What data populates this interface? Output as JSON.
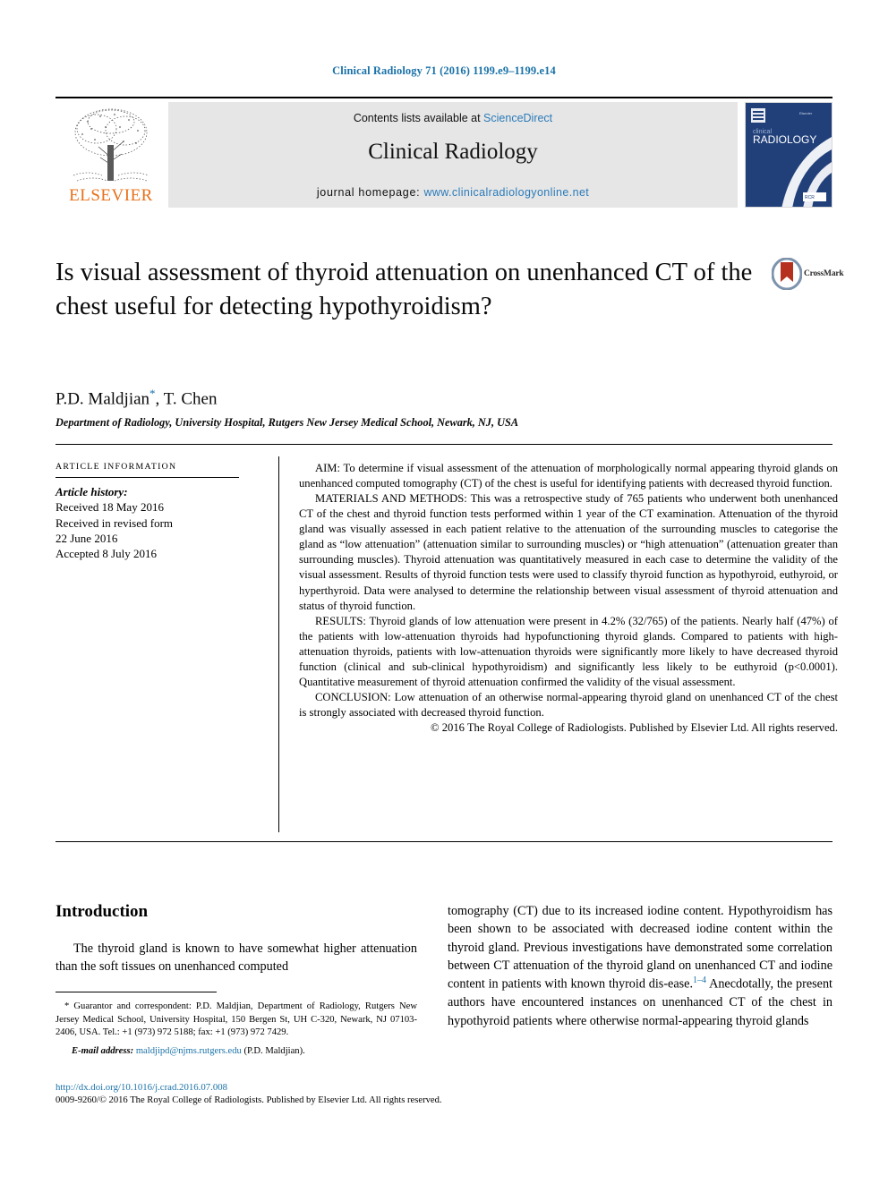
{
  "running_head": "Clinical Radiology 71 (2016) 1199.e9–1199.e14",
  "masthead": {
    "publisher_name": "ELSEVIER",
    "publisher_logo_icon": "elsevier-tree-icon",
    "contents_prefix": "Contents lists available at ",
    "contents_link": "ScienceDirect",
    "journal_name": "Clinical Radiology",
    "homepage_prefix": "journal homepage: ",
    "homepage_url": "www.clinicalradiologyonline.net",
    "cover_icon": "journal-cover-thumbnail",
    "cover_title_line1": "clinical",
    "cover_title_line2": "RADIOLOGY"
  },
  "crossmark": {
    "label": "CrossMark",
    "icon": "crossmark-icon"
  },
  "article": {
    "title": "Is visual assessment of thyroid attenuation on unenhanced CT of the chest useful for detecting hypothyroidism?",
    "authors": "P.D. Maldjian",
    "authors_marker": "*",
    "authors_rest": ", T. Chen",
    "affiliation": "Department of Radiology, University Hospital, Rutgers New Jersey Medical School, Newark, NJ, USA"
  },
  "article_information": {
    "heading": "ARTICLE INFORMATION",
    "history_label": "Article history:",
    "history": [
      "Received 18 May 2016",
      "Received in revised form",
      "22 June 2016",
      "Accepted 8 July 2016"
    ]
  },
  "abstract": {
    "aim": "AIM: To determine if visual assessment of the attenuation of morphologically normal appearing thyroid glands on unenhanced computed tomography (CT) of the chest is useful for identifying patients with decreased thyroid function.",
    "materials_and_methods": "MATERIALS AND METHODS: This was a retrospective study of 765 patients who underwent both unenhanced CT of the chest and thyroid function tests performed within 1 year of the CT examination. Attenuation of the thyroid gland was visually assessed in each patient relative to the attenuation of the surrounding muscles to categorise the gland as “low attenuation” (attenuation similar to surrounding muscles) or “high attenuation” (attenuation greater than surrounding muscles). Thyroid attenuation was quantitatively measured in each case to determine the validity of the visual assessment. Results of thyroid function tests were used to classify thyroid function as hypothyroid, euthyroid, or hyperthyroid. Data were analysed to determine the relationship between visual assessment of thyroid attenuation and status of thyroid function.",
    "results": "RESULTS: Thyroid glands of low attenuation were present in 4.2% (32/765) of the patients. Nearly half (47%) of the patients with low-attenuation thyroids had hypofunctioning thyroid glands. Compared to patients with high-attenuation thyroids, patients with low-attenuation thyroids were significantly more likely to have decreased thyroid function (clinical and sub-clinical hypothyroidism) and significantly less likely to be euthyroid (p<0.0001). Quantitative measurement of thyroid attenuation confirmed the validity of the visual assessment.",
    "conclusion": "CONCLUSION: Low attenuation of an otherwise normal-appearing thyroid gland on unenhanced CT of the chest is strongly associated with decreased thyroid function.",
    "copyright": "© 2016 The Royal College of Radiologists. Published by Elsevier Ltd. All rights reserved."
  },
  "body": {
    "introduction_heading": "Introduction",
    "left_paragraph": "The thyroid gland is known to have somewhat higher attenuation than the soft tissues on unenhanced computed",
    "right_paragraph_1": "tomography (CT) due to its increased iodine content. Hypothyroidism has been shown to be associated with decreased iodine content within the thyroid gland. Previous investigations have demonstrated some correlation between CT attenuation of the thyroid gland on unenhanced CT and iodine content in patients with known thyroid dis-ease.",
    "right_reference_marker": "1–4",
    "right_paragraph_2": " Anecdotally, the present authors have encountered instances on unenhanced CT of the chest in hypothyroid patients where otherwise normal-appearing thyroid glands"
  },
  "footnotes": {
    "correspondence": "* Guarantor and correspondent: P.D. Maldjian, Department of Radiology, Rutgers New Jersey Medical School, University Hospital, 150 Bergen St, UH C-320, Newark, NJ 07103-2406, USA. Tel.: +1 (973) 972 5188; fax: +1 (973) 972 7429.",
    "email_label": "E-mail address:",
    "email": "maldjipd@njms.rutgers.edu",
    "email_suffix": "(P.D. Maldjian)."
  },
  "doi": {
    "url": "http://dx.doi.org/10.1016/j.crad.2016.07.008",
    "issn_line": "0009-9260/© 2016 The Royal College of Radiologists. Published by Elsevier Ltd. All rights reserved."
  },
  "colors": {
    "link_blue": "#1a72a8",
    "banner_gray": "#e6e6e6",
    "elsevier_orange": "#e8701a",
    "crossmark_red": "#b5301e",
    "cover_navy": "#1f3a6e"
  }
}
